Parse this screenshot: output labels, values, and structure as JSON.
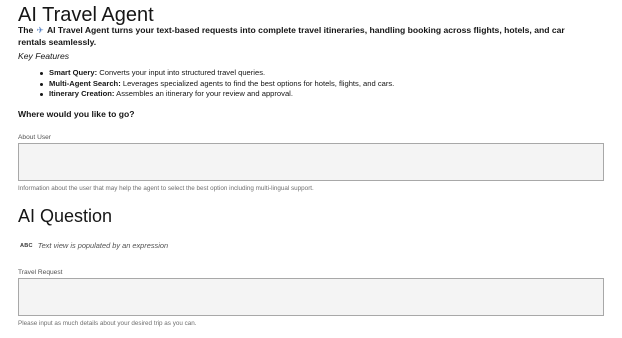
{
  "header": {
    "title": "AI Travel Agent"
  },
  "intro": {
    "lead": "The",
    "plane_icon": "airplane-icon",
    "text": "AI Travel Agent turns your text-based requests into complete travel itineraries, handling booking across flights, hotels, and car rentals seamlessly."
  },
  "features": {
    "title": "Key Features",
    "items": [
      {
        "name": "Smart Query:",
        "desc": "Converts your input into structured travel queries."
      },
      {
        "name": "Multi-Agent Search:",
        "desc": "Leverages specialized agents to find the best options for hotels, flights, and cars."
      },
      {
        "name": "Itinerary Creation:",
        "desc": "Assembles an itinerary for your review and approval."
      }
    ]
  },
  "prompt": {
    "question": "Where would you like to go?"
  },
  "about_user": {
    "label": "About User",
    "value": "",
    "helper": "Information about the user that may help the agent to select the best option including multi-lingual support."
  },
  "ai_question": {
    "title": "AI Question",
    "expression_icon": "abc-text-icon",
    "expression_badge": "ABC",
    "expression_text": "Text view is populated by an expression"
  },
  "travel_request": {
    "label": "Travel Request",
    "value": "",
    "helper": "Please input as much details about your desired trip as you can."
  },
  "colors": {
    "field_background": "#f4f4f4",
    "field_border": "#a8a8a8",
    "text_primary": "#161616",
    "text_secondary": "#525252",
    "helper_text": "#6f6f6f"
  }
}
